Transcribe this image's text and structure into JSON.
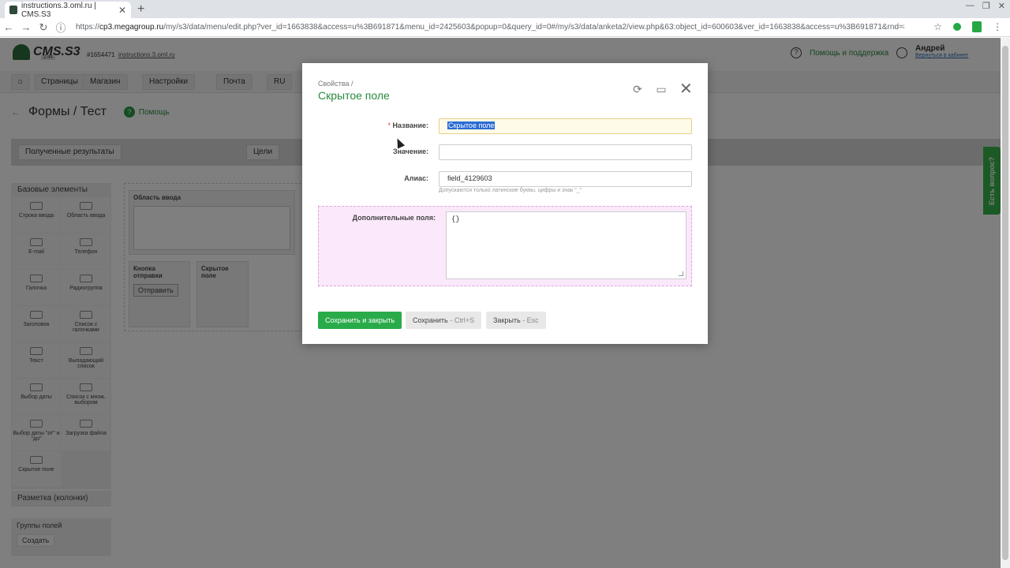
{
  "browser": {
    "tab_title": "instructions.3.oml.ru | CMS.S3",
    "url_prefix": "https://",
    "url_host": "cp3.megagroup.ru",
    "url_path": "/my/s3/data/menu/edit.php?ver_id=1663838&access=u%3B691871&menu_id=2425603&popup=0&query_id=0#/my/s3/data/anketa2/view.php&63:object_id=600603&ver_id=1663838&access=u%3B691871&rnd=8633"
  },
  "cms": {
    "logo": "CMS.S3",
    "version": "2.44",
    "site_id": "#1654471",
    "site_link": "instructions.3.oml.ru",
    "help_label": "Помощь и поддержка",
    "user_name": "Андрей",
    "user_link": "Вернуться в кабинет",
    "nav": [
      "Страницы",
      "Магазин",
      "Настройки",
      "Почта",
      "RU"
    ]
  },
  "page": {
    "title": "Формы / Тест",
    "help": "Помощь",
    "results_button": "Полученные результаты",
    "goals_button": "Цели"
  },
  "left_panel": {
    "section": "Базовые элементы",
    "items": [
      "Строка ввода",
      "Область ввода",
      "E-mail",
      "Телефон",
      "Галочка",
      "Радиогруппа",
      "Заголовок",
      "Список с галочками",
      "Текст",
      "Выпадающий список",
      "Выбор даты",
      "Список с множ. выбором",
      "Выбор даты \"от\" и \"до\"",
      "Загрузка файла",
      "Скрытое поле"
    ],
    "layout_section": "Разметка (колонки)",
    "groups_section": "Группы полей",
    "create_button": "Создать"
  },
  "canvas": {
    "input_area_label": "Область ввода",
    "submit_label": "Кнопка отправки",
    "submit_button": "Отправить",
    "hidden_label": "Скрытое поле"
  },
  "feedback_tab": "Есть вопрос?",
  "modal": {
    "breadcrumb": "Свойства /",
    "title": "Скрытое поле",
    "name_label": "Название:",
    "name_required": "*",
    "name_value": "Скрытое поле",
    "value_label": "Значение:",
    "value_value": "",
    "alias_label": "Алиас:",
    "alias_value": "field_4129603",
    "alias_hint": "Допускаются только латинские буквы, цифры и знак \"_\"",
    "extra_label": "Дополнительные поля:",
    "extra_value": "{}",
    "save_close": "Сохранить и закрыть",
    "save": "Сохранить",
    "save_kbd": " - Ctrl+S",
    "close": "Закрыть",
    "close_kbd": " - Esc"
  },
  "colors": {
    "accent": "#2aab4a",
    "title_green": "#2a8a3c",
    "extra_bg": "#fbe8fb"
  }
}
